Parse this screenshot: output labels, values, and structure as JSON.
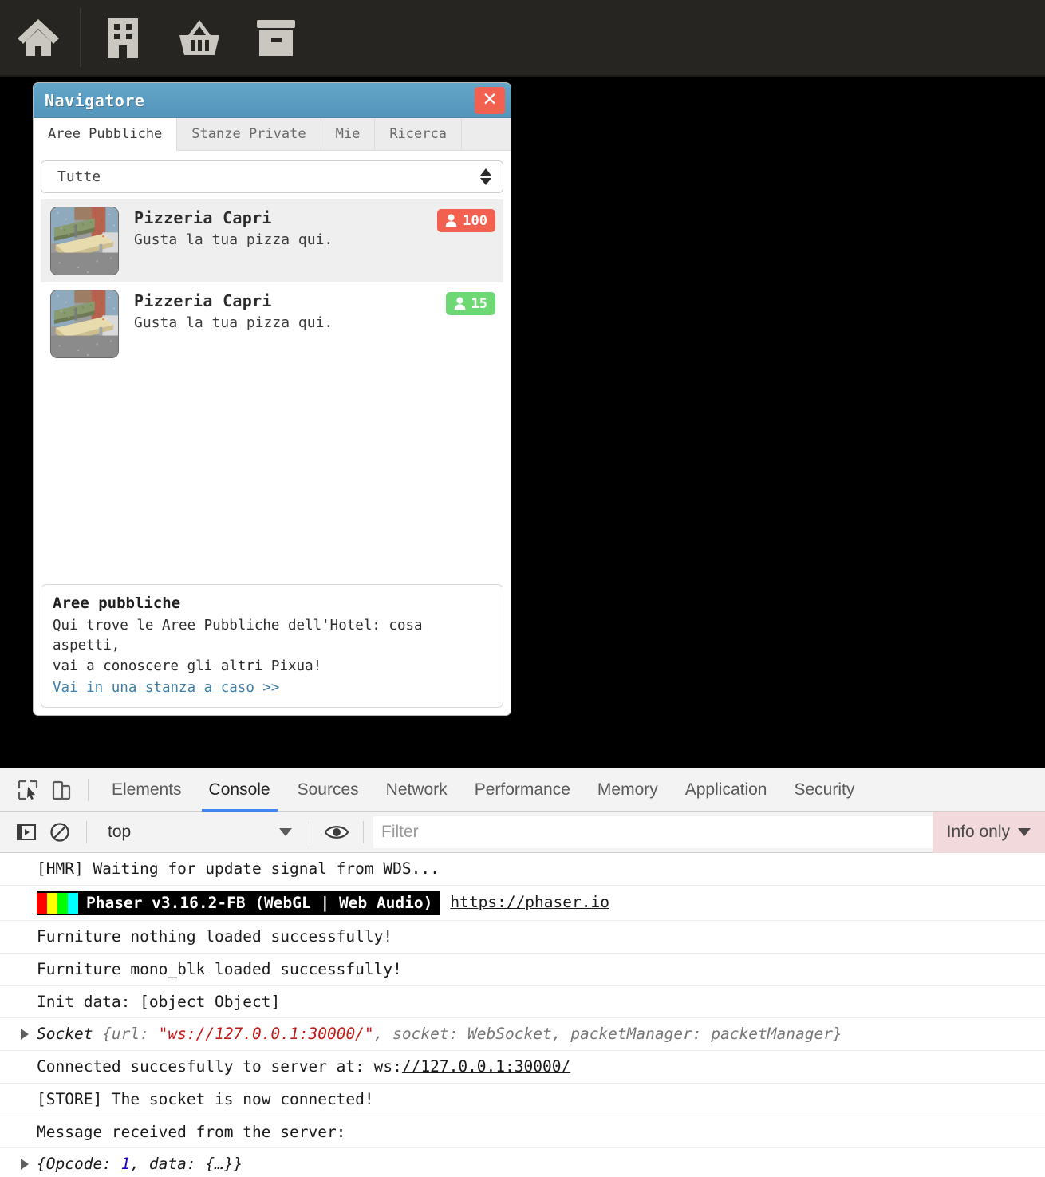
{
  "toolbar": {
    "buttons": [
      {
        "name": "home-icon",
        "label": "Home"
      },
      {
        "name": "hotel-icon",
        "label": "Hotel"
      },
      {
        "name": "shop-basket-icon",
        "label": "Negozio"
      },
      {
        "name": "inventory-box-icon",
        "label": "Inventario"
      }
    ]
  },
  "navigator": {
    "title": "Navigatore",
    "close_label": "✕",
    "tabs": [
      {
        "label": "Aree Pubbliche",
        "active": true
      },
      {
        "label": "Stanze Private",
        "active": false
      },
      {
        "label": "Mie",
        "active": false
      },
      {
        "label": "Ricerca",
        "active": false
      }
    ],
    "filter_select": {
      "value": "Tutte"
    },
    "rooms": [
      {
        "name": "Pizzeria Capri",
        "description": "Gusta la tua pizza qui.",
        "count": "100",
        "badge_color": "#f2604f",
        "selected": true
      },
      {
        "name": "Pizzeria Capri",
        "description": "Gusta la tua pizza qui.",
        "count": "15",
        "badge_color": "#6ed974",
        "selected": false
      }
    ],
    "info": {
      "title": "Aree pubbliche",
      "line1": "Qui trove le Aree Pubbliche dell'Hotel: cosa aspetti,",
      "line2": "vai a conoscere gli altri Pixua!",
      "link": "Vai in una stanza a caso >>"
    }
  },
  "devtools": {
    "tabs": [
      {
        "label": "Elements",
        "active": false
      },
      {
        "label": "Console",
        "active": true
      },
      {
        "label": "Sources",
        "active": false
      },
      {
        "label": "Network",
        "active": false
      },
      {
        "label": "Performance",
        "active": false
      },
      {
        "label": "Memory",
        "active": false
      },
      {
        "label": "Application",
        "active": false
      },
      {
        "label": "Security",
        "active": false
      }
    ],
    "context_value": "top",
    "filter_placeholder": "Filter",
    "filter_value": "",
    "level_value": "Info only",
    "console": {
      "row1": "[HMR] Waiting for update signal from WDS...",
      "row2_badge": "Phaser v3.16.2-FB (WebGL | Web Audio)",
      "row2_link": "https://phaser.io",
      "row2_bar_colors": [
        "#ff0000",
        "#ffff00",
        "#00ff00",
        "#00ffff"
      ],
      "row3": "Furniture nothing loaded successfully!",
      "row4": "Furniture mono_blk loaded successfully!",
      "row5": "Init data: [object Object]",
      "row6_a": "Socket ",
      "row6_b": "{url: ",
      "row6_url": "\"ws://127.0.0.1:30000/\"",
      "row6_c": ", socket: WebSocket, packetManager: packetManager}",
      "row7_a": "Connected succesfully to server at: ws:",
      "row7_link": "//127.0.0.1:30000/",
      "row8": "[STORE] The socket is now connected!",
      "row9": "Message received from the server:",
      "row10_a": "{Opcode: ",
      "row10_num": "1",
      "row10_b": ", data: {…}}"
    }
  }
}
